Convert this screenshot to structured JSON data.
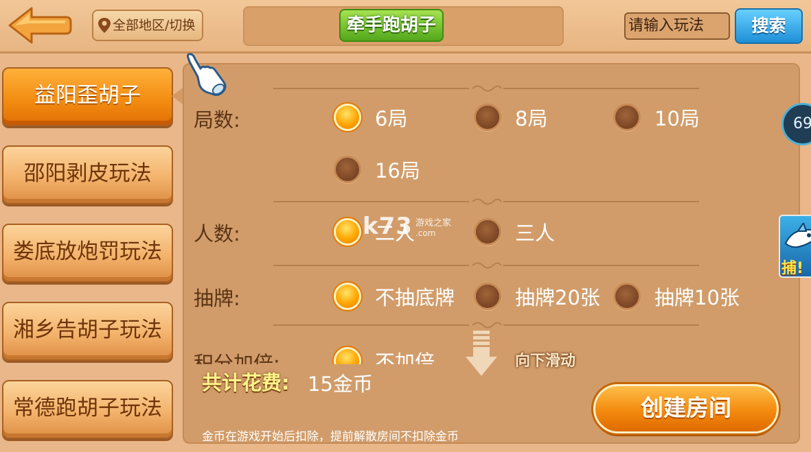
{
  "header": {
    "region_button": "全部地区/切换",
    "title": "牵手跑胡子",
    "search_placeholder": "请输入玩法",
    "search_button": "搜索"
  },
  "tabs": [
    {
      "label": "益阳歪胡子",
      "active": true
    },
    {
      "label": "邵阳剥皮玩法",
      "active": false
    },
    {
      "label": "娄底放炮罚玩法",
      "active": false
    },
    {
      "label": "湘乡告胡子玩法",
      "active": false
    },
    {
      "label": "常德跑胡子玩法",
      "active": false
    }
  ],
  "options": {
    "rounds": {
      "label": "局数:",
      "choices": [
        {
          "text": "6局",
          "selected": true
        },
        {
          "text": "8局",
          "selected": false
        },
        {
          "text": "10局",
          "selected": false
        },
        {
          "text": "16局",
          "selected": false
        }
      ]
    },
    "players": {
      "label": "人数:",
      "choices": [
        {
          "text": "二人",
          "selected": true
        },
        {
          "text": "三人",
          "selected": false
        }
      ]
    },
    "draw": {
      "label": "抽牌:",
      "choices": [
        {
          "text": "不抽底牌",
          "selected": true
        },
        {
          "text": "抽牌20张",
          "selected": false
        },
        {
          "text": "抽牌10张",
          "selected": false
        }
      ]
    },
    "multiplier": {
      "label": "积分加倍:",
      "choices": [
        {
          "text": "不加倍",
          "selected": true
        }
      ]
    }
  },
  "scroll_hint": "向下滑动",
  "cost": {
    "label": "共计花费:",
    "value": "15金币"
  },
  "note": "金币在游戏开始后扣除，提前解散房间不扣除金币",
  "create_button": "创建房间",
  "side": {
    "counter": "69",
    "game_label": "捕!"
  },
  "watermark": {
    "main": "k73",
    "sub1": "游戏之家",
    "sub2": ".com"
  },
  "colors": {
    "accent_orange": "#f28a10",
    "search_blue": "#1f8fd7",
    "title_green": "#53a81c",
    "panel": "#d19c6a"
  }
}
